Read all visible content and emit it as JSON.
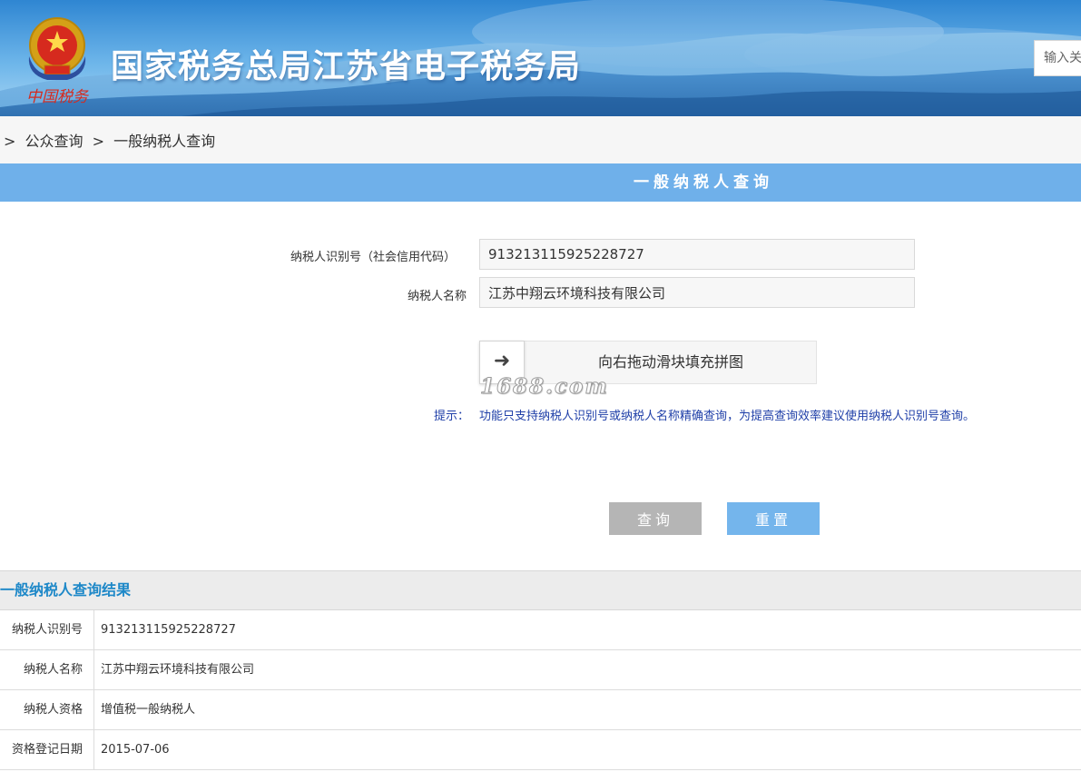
{
  "header": {
    "title": "国家税务总局江苏省电子税务局",
    "emblem_caption": "中国税务",
    "search_placeholder": "输入关键字"
  },
  "breadcrumb": {
    "separator": ">",
    "items": [
      "公众查询",
      "一般纳税人查询"
    ]
  },
  "section": {
    "title": "一般纳税人查询"
  },
  "form": {
    "taxpayer_id_label": "纳税人识别号（社会信用代码）",
    "taxpayer_id_value": "913213115925228727",
    "taxpayer_name_label": "纳税人名称",
    "taxpayer_name_value": "江苏中翔云环境科技有限公司",
    "slider_arrow": "➜",
    "slider_text": "向右拖动滑块填充拼图",
    "watermark": "1688.com",
    "hint_label": "提示：",
    "hint_text": "功能只支持纳税人识别号或纳税人名称精确查询，为提高查询效率建议使用纳税人识别号查询。",
    "query_button": "查询",
    "reset_button": "重置"
  },
  "results": {
    "title": "一般纳税人查询结果",
    "rows": [
      {
        "label": "纳税人识别号",
        "value": "913213115925228727"
      },
      {
        "label": "纳税人名称",
        "value": "江苏中翔云环境科技有限公司"
      },
      {
        "label": "纳税人资格",
        "value": "增值税一般纳税人"
      },
      {
        "label": "资格登记日期",
        "value": "2015-07-06"
      }
    ]
  },
  "colors": {
    "title_bar": "#6fb0ea",
    "query_button": "#b5b5b5",
    "reset_button": "#74b5ec",
    "hint_text": "#1f3fa8",
    "result_title": "#1e88c8"
  }
}
